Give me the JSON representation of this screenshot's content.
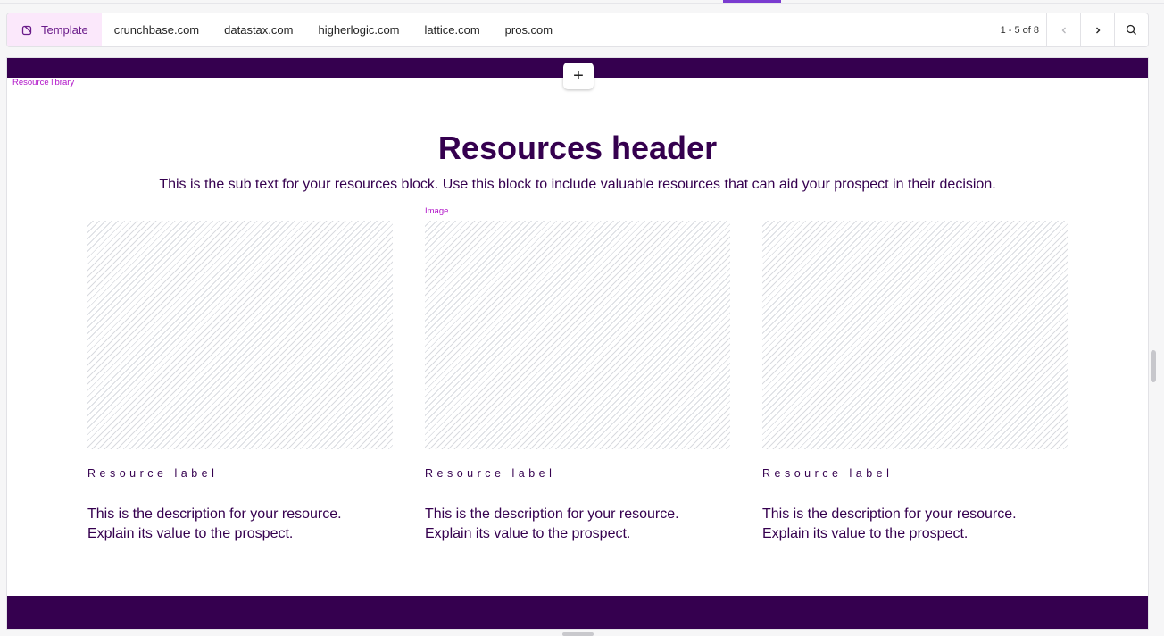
{
  "tabs": {
    "items": [
      {
        "label": "Template",
        "active": true
      },
      {
        "label": "crunchbase.com"
      },
      {
        "label": "datastax.com"
      },
      {
        "label": "higherlogic.com"
      },
      {
        "label": "lattice.com"
      },
      {
        "label": "pros.com"
      }
    ],
    "pagination": "1 - 5 of 8",
    "icons": {
      "template": "template-icon",
      "prev": "chevron-left-icon",
      "next": "chevron-right-icon",
      "search": "search-icon"
    }
  },
  "canvas": {
    "add_button_label": "+",
    "block_tag": "Resource library",
    "header": "Resources header",
    "subtext": "This is the sub text for your resources block. Use this block to include valuable resources that can aid your prospect in their decision.",
    "image_tag": "Image",
    "cards": [
      {
        "label": "Resource label",
        "desc_line1": "This is the description for your resource.",
        "desc_line2": "Explain its value to the prospect."
      },
      {
        "label": "Resource label",
        "desc_line1": "This is the description for your resource.",
        "desc_line2": "Explain its value to the prospect."
      },
      {
        "label": "Resource label",
        "desc_line1": "This is the description for your resource.",
        "desc_line2": "Explain its value to the prospect."
      }
    ]
  },
  "colors": {
    "brand": "#35004f",
    "accent_tag": "#b012c8",
    "active_tab_bg": "#fbe8fb"
  }
}
